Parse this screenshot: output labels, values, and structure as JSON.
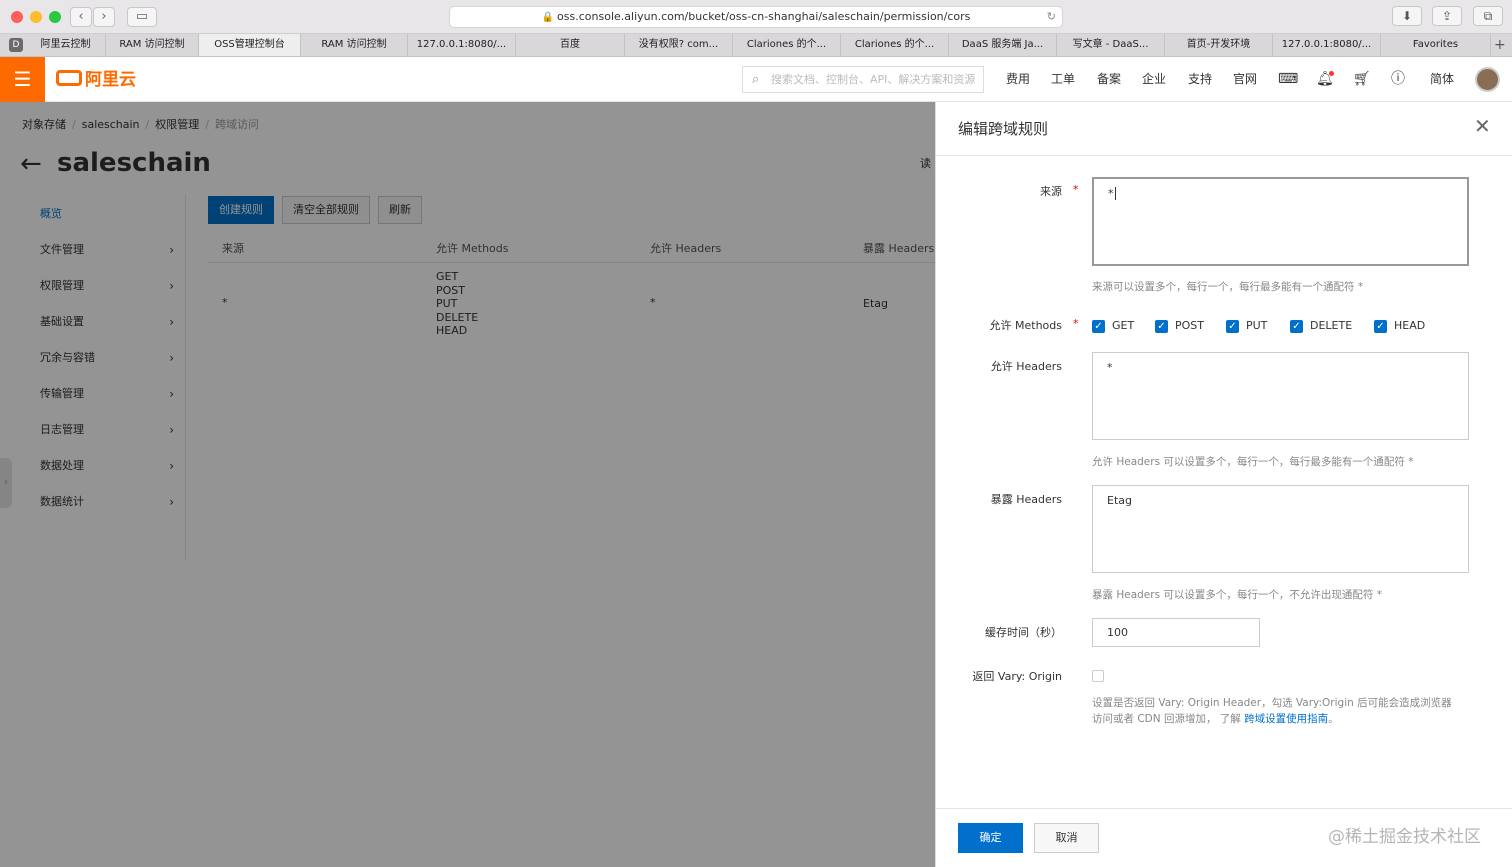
{
  "browser": {
    "url": "oss.console.aliyun.com/bucket/oss-cn-shanghai/saleschain/permission/cors",
    "tab_icon": "D",
    "tabs": [
      "阿里云控制",
      "RAM 访问控制",
      "OSS管理控制台",
      "RAM 访问控制",
      "127.0.0.1:8080/...",
      "百度",
      "没有权限? com...",
      "Clariones 的个...",
      "Clariones 的个...",
      "DaaS 服务端 Ja...",
      "写文章 - DaaS...",
      "首页-开发环境",
      "127.0.0.1:8080/...",
      "Favorites"
    ],
    "active_tab": 2
  },
  "topbar": {
    "logo": "阿里云",
    "search_placeholder": "搜索文档、控制台、API、解决方案和资源",
    "nav": [
      "费用",
      "工单",
      "备案",
      "企业",
      "支持",
      "官网"
    ],
    "lang": "简体"
  },
  "page": {
    "breadcrumb": [
      "对象存储",
      "saleschain",
      "权限管理",
      "跨域访问"
    ],
    "title": "saleschain",
    "sidebar": [
      "概览",
      "文件管理",
      "权限管理",
      "基础设置",
      "冗余与容错",
      "传输管理",
      "日志管理",
      "数据处理",
      "数据统计"
    ],
    "buttons": {
      "create": "创建规则",
      "clear": "清空全部规则",
      "refresh": "刷新"
    },
    "table": {
      "headers": [
        "来源",
        "允许 Methods",
        "允许 Headers",
        "暴露 Headers"
      ],
      "row": {
        "origin": "*",
        "methods": [
          "GET",
          "POST",
          "PUT",
          "DELETE",
          "HEAD"
        ],
        "allow_headers": "*",
        "expose_headers": "Etag"
      }
    },
    "right_cut_text": "读"
  },
  "dialog": {
    "title": "编辑跨域规则",
    "origin_label": "来源",
    "origin_value": "*",
    "origin_hint": "来源可以设置多个，每行一个，每行最多能有一个通配符 *",
    "methods_label": "允许 Methods",
    "methods": [
      "GET",
      "POST",
      "PUT",
      "DELETE",
      "HEAD"
    ],
    "allow_headers_label": "允许 Headers",
    "allow_headers_value": "*",
    "allow_headers_hint": "允许 Headers 可以设置多个，每行一个，每行最多能有一个通配符 *",
    "expose_headers_label": "暴露 Headers",
    "expose_headers_value": "Etag",
    "expose_headers_hint": "暴露 Headers 可以设置多个，每行一个，不允许出现通配符 *",
    "cache_label": "缓存时间（秒）",
    "cache_value": "100",
    "vary_label": "返回 Vary: Origin",
    "vary_hint_1": "设置是否返回 Vary: Origin Header，勾选 Vary:Origin 后可能会造成浏览器",
    "vary_hint_2": "访问或者 CDN 回源增加， 了解 ",
    "vary_link": "跨域设置使用指南",
    "vary_hint_end": "。",
    "ok": "确定",
    "cancel": "取消"
  },
  "watermark": "@稀土掘金技术社区"
}
